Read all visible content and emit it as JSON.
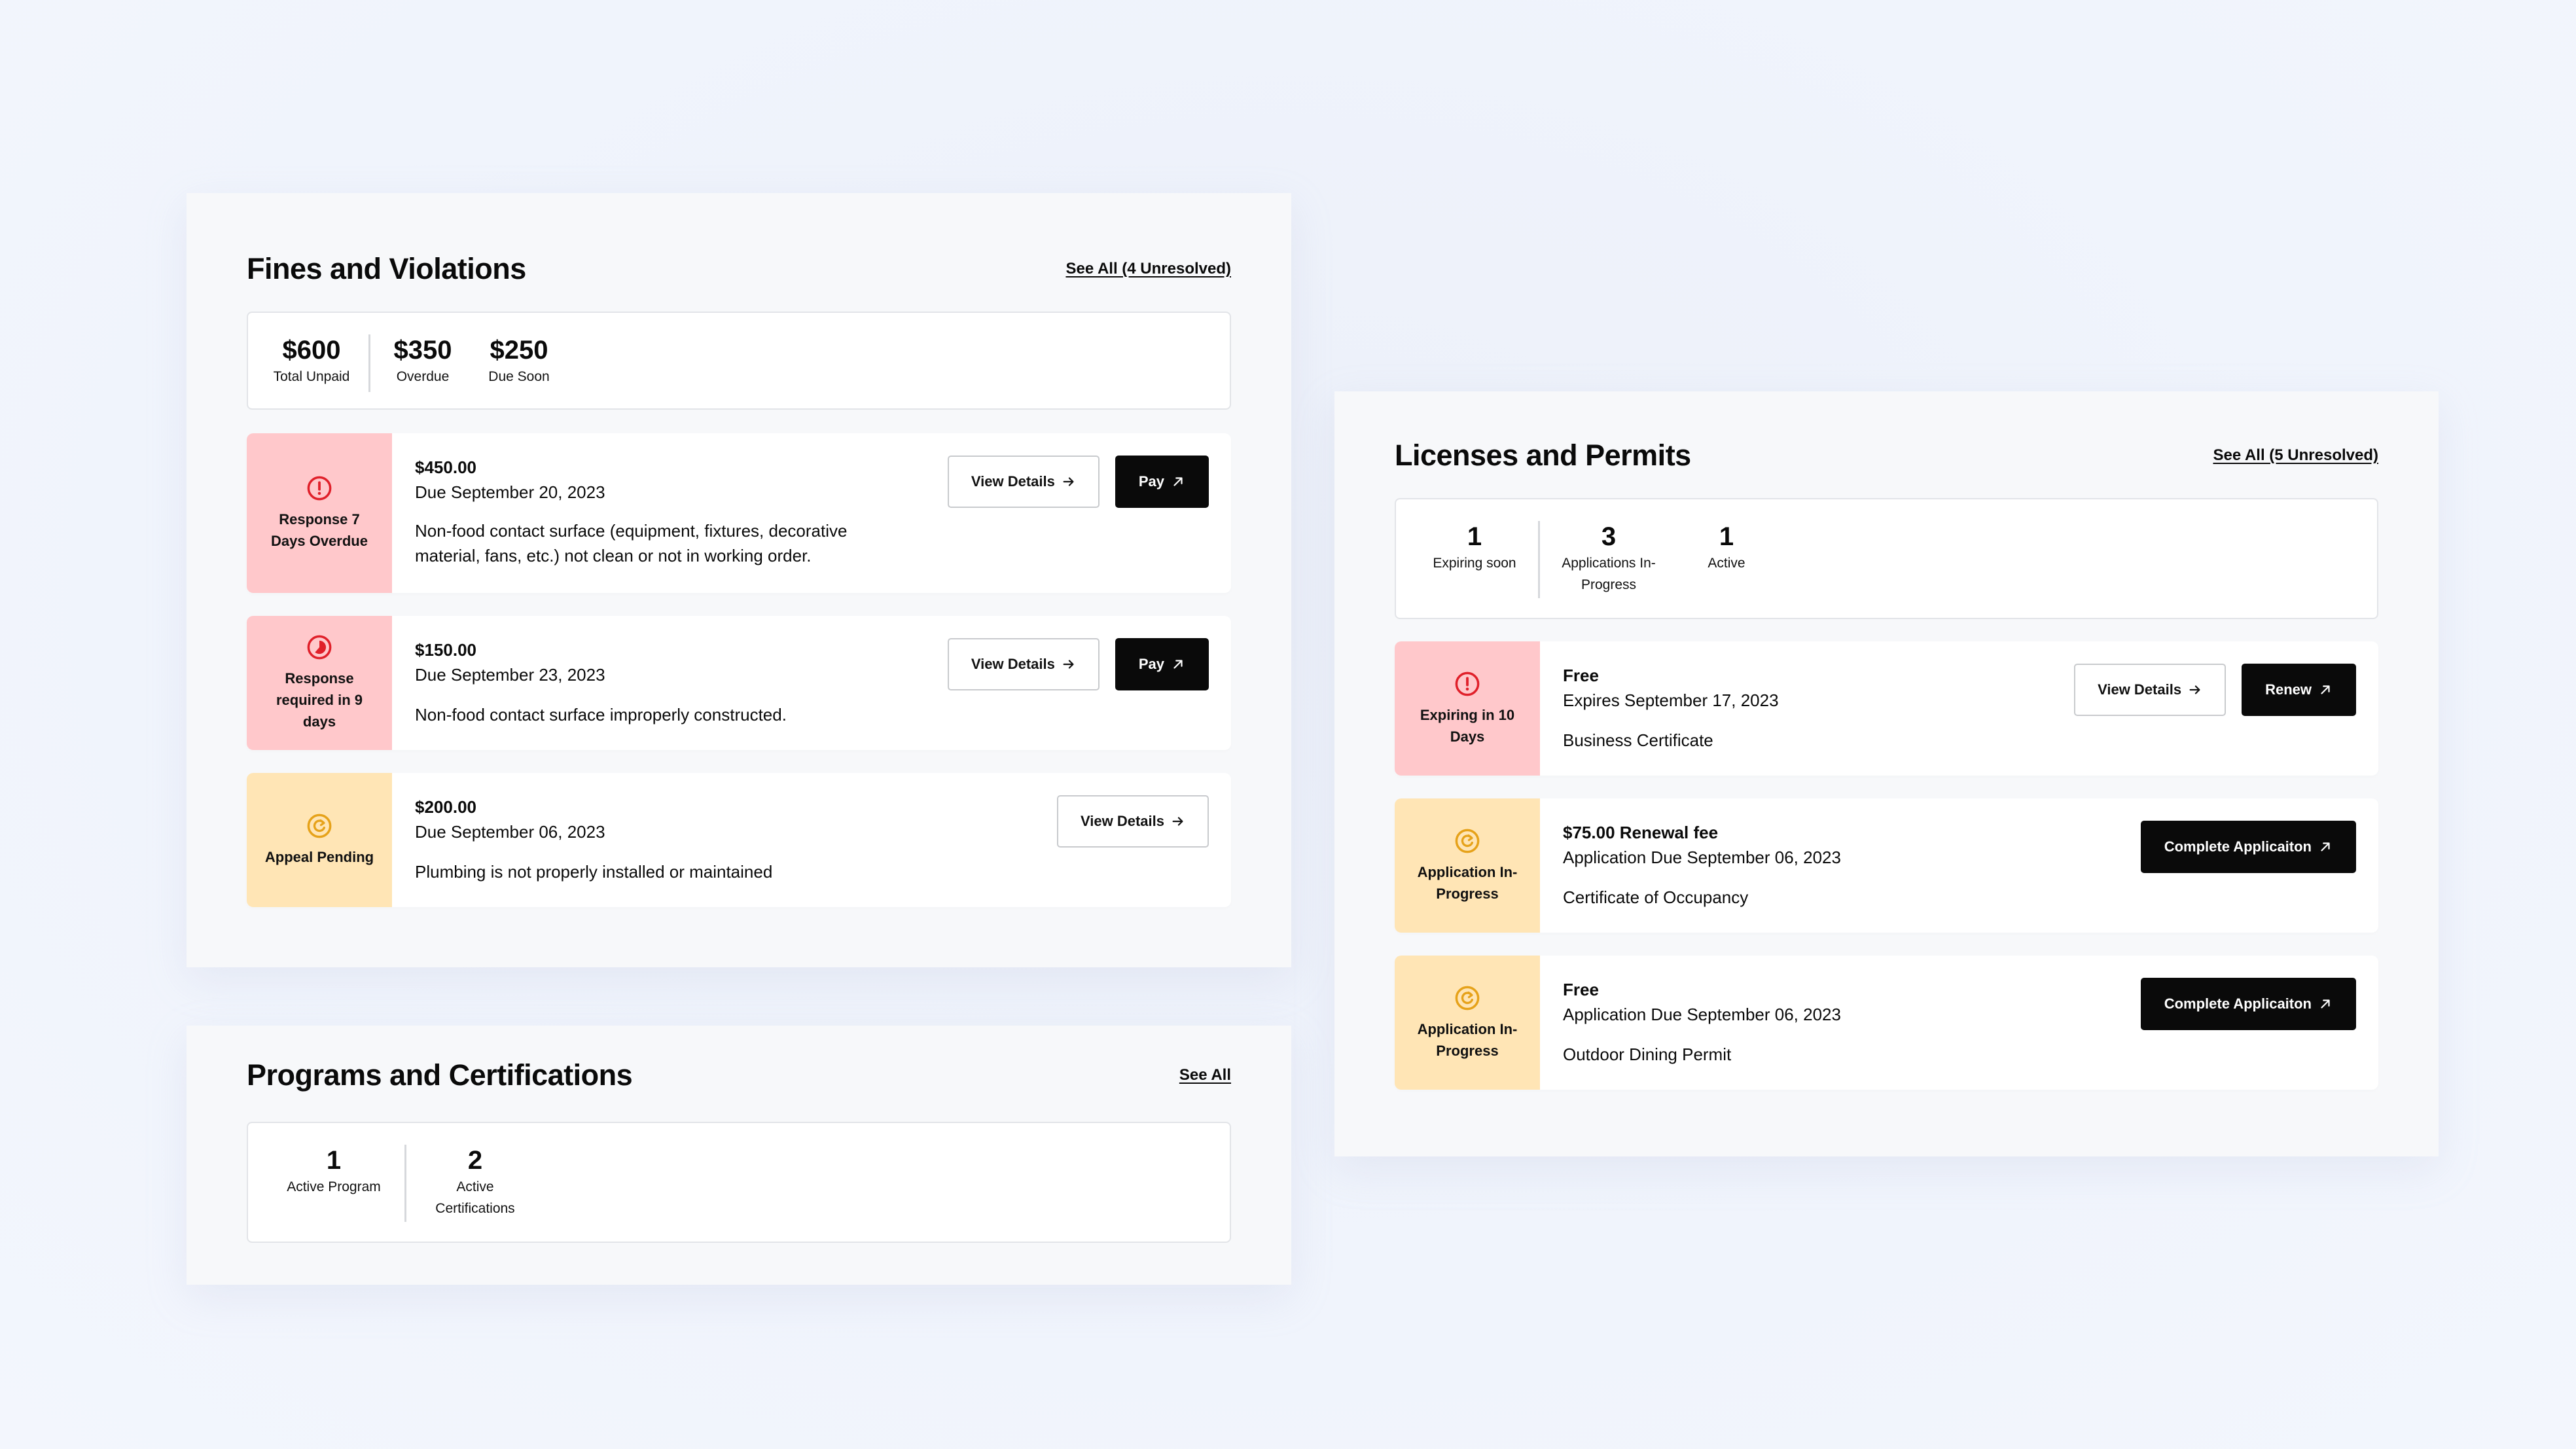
{
  "colors": {
    "danger": "#e0202a",
    "danger_bg": "#ffc8cb",
    "warning": "#e6a21a",
    "warning_bg": "#ffe5b5",
    "primary_button": "#0a0a0a"
  },
  "fines": {
    "title": "Fines and Violations",
    "see_all": "See All (4 Unresolved)",
    "summary": [
      {
        "value": "$600",
        "label": "Total Unpaid"
      },
      {
        "value": "$350",
        "label": "Overdue"
      },
      {
        "value": "$250",
        "label": "Due Soon"
      }
    ],
    "items": [
      {
        "status": "Response 7 Days Overdue",
        "status_icon": "alert-circle-icon",
        "amount": "$450.00",
        "date": "Due September 20, 2023",
        "description": "Non-food contact surface (equipment, fixtures, decorative material, fans, etc.) not clean or not in working order.",
        "view_details": "View Details",
        "pay": "Pay"
      },
      {
        "status": "Response required in 9 days",
        "status_icon": "timer-icon",
        "amount": "$150.00",
        "date": "Due September 23, 2023",
        "description": "Non-food contact surface improperly constructed.",
        "view_details": "View Details",
        "pay": "Pay"
      },
      {
        "status": "Appeal Pending",
        "status_icon": "refresh-circle-icon",
        "amount": "$200.00",
        "date": "Due September 06, 2023",
        "description": "Plumbing is not properly installed or maintained",
        "view_details": "View Details"
      }
    ]
  },
  "programs": {
    "title": "Programs and Certifications",
    "see_all": "See All",
    "summary": [
      {
        "value": "1",
        "label": "Active Program"
      },
      {
        "value": "2",
        "label": "Active Certifications"
      }
    ]
  },
  "licenses": {
    "title": "Licenses and Permits",
    "see_all": "See All (5 Unresolved)",
    "summary": [
      {
        "value": "1",
        "label": "Expiring soon"
      },
      {
        "value": "3",
        "label": "Applications In-Progress"
      },
      {
        "value": "1",
        "label": "Active"
      }
    ],
    "items": [
      {
        "status": "Expiring in 10 Days",
        "status_icon": "alert-circle-icon",
        "amount": "Free",
        "date": "Expires September 17, 2023",
        "description": "Business Certificate",
        "view_details": "View Details",
        "action": "Renew"
      },
      {
        "status": "Application In-Progress",
        "status_icon": "refresh-circle-icon",
        "amount": "$75.00 Renewal fee",
        "date": "Application Due September 06, 2023",
        "description": "Certificate of Occupancy",
        "action": "Complete Applicaiton"
      },
      {
        "status": "Application In-Progress",
        "status_icon": "refresh-circle-icon",
        "amount": "Free",
        "date": "Application Due September 06, 2023",
        "description": "Outdoor Dining Permit",
        "action": "Complete Applicaiton"
      }
    ]
  }
}
